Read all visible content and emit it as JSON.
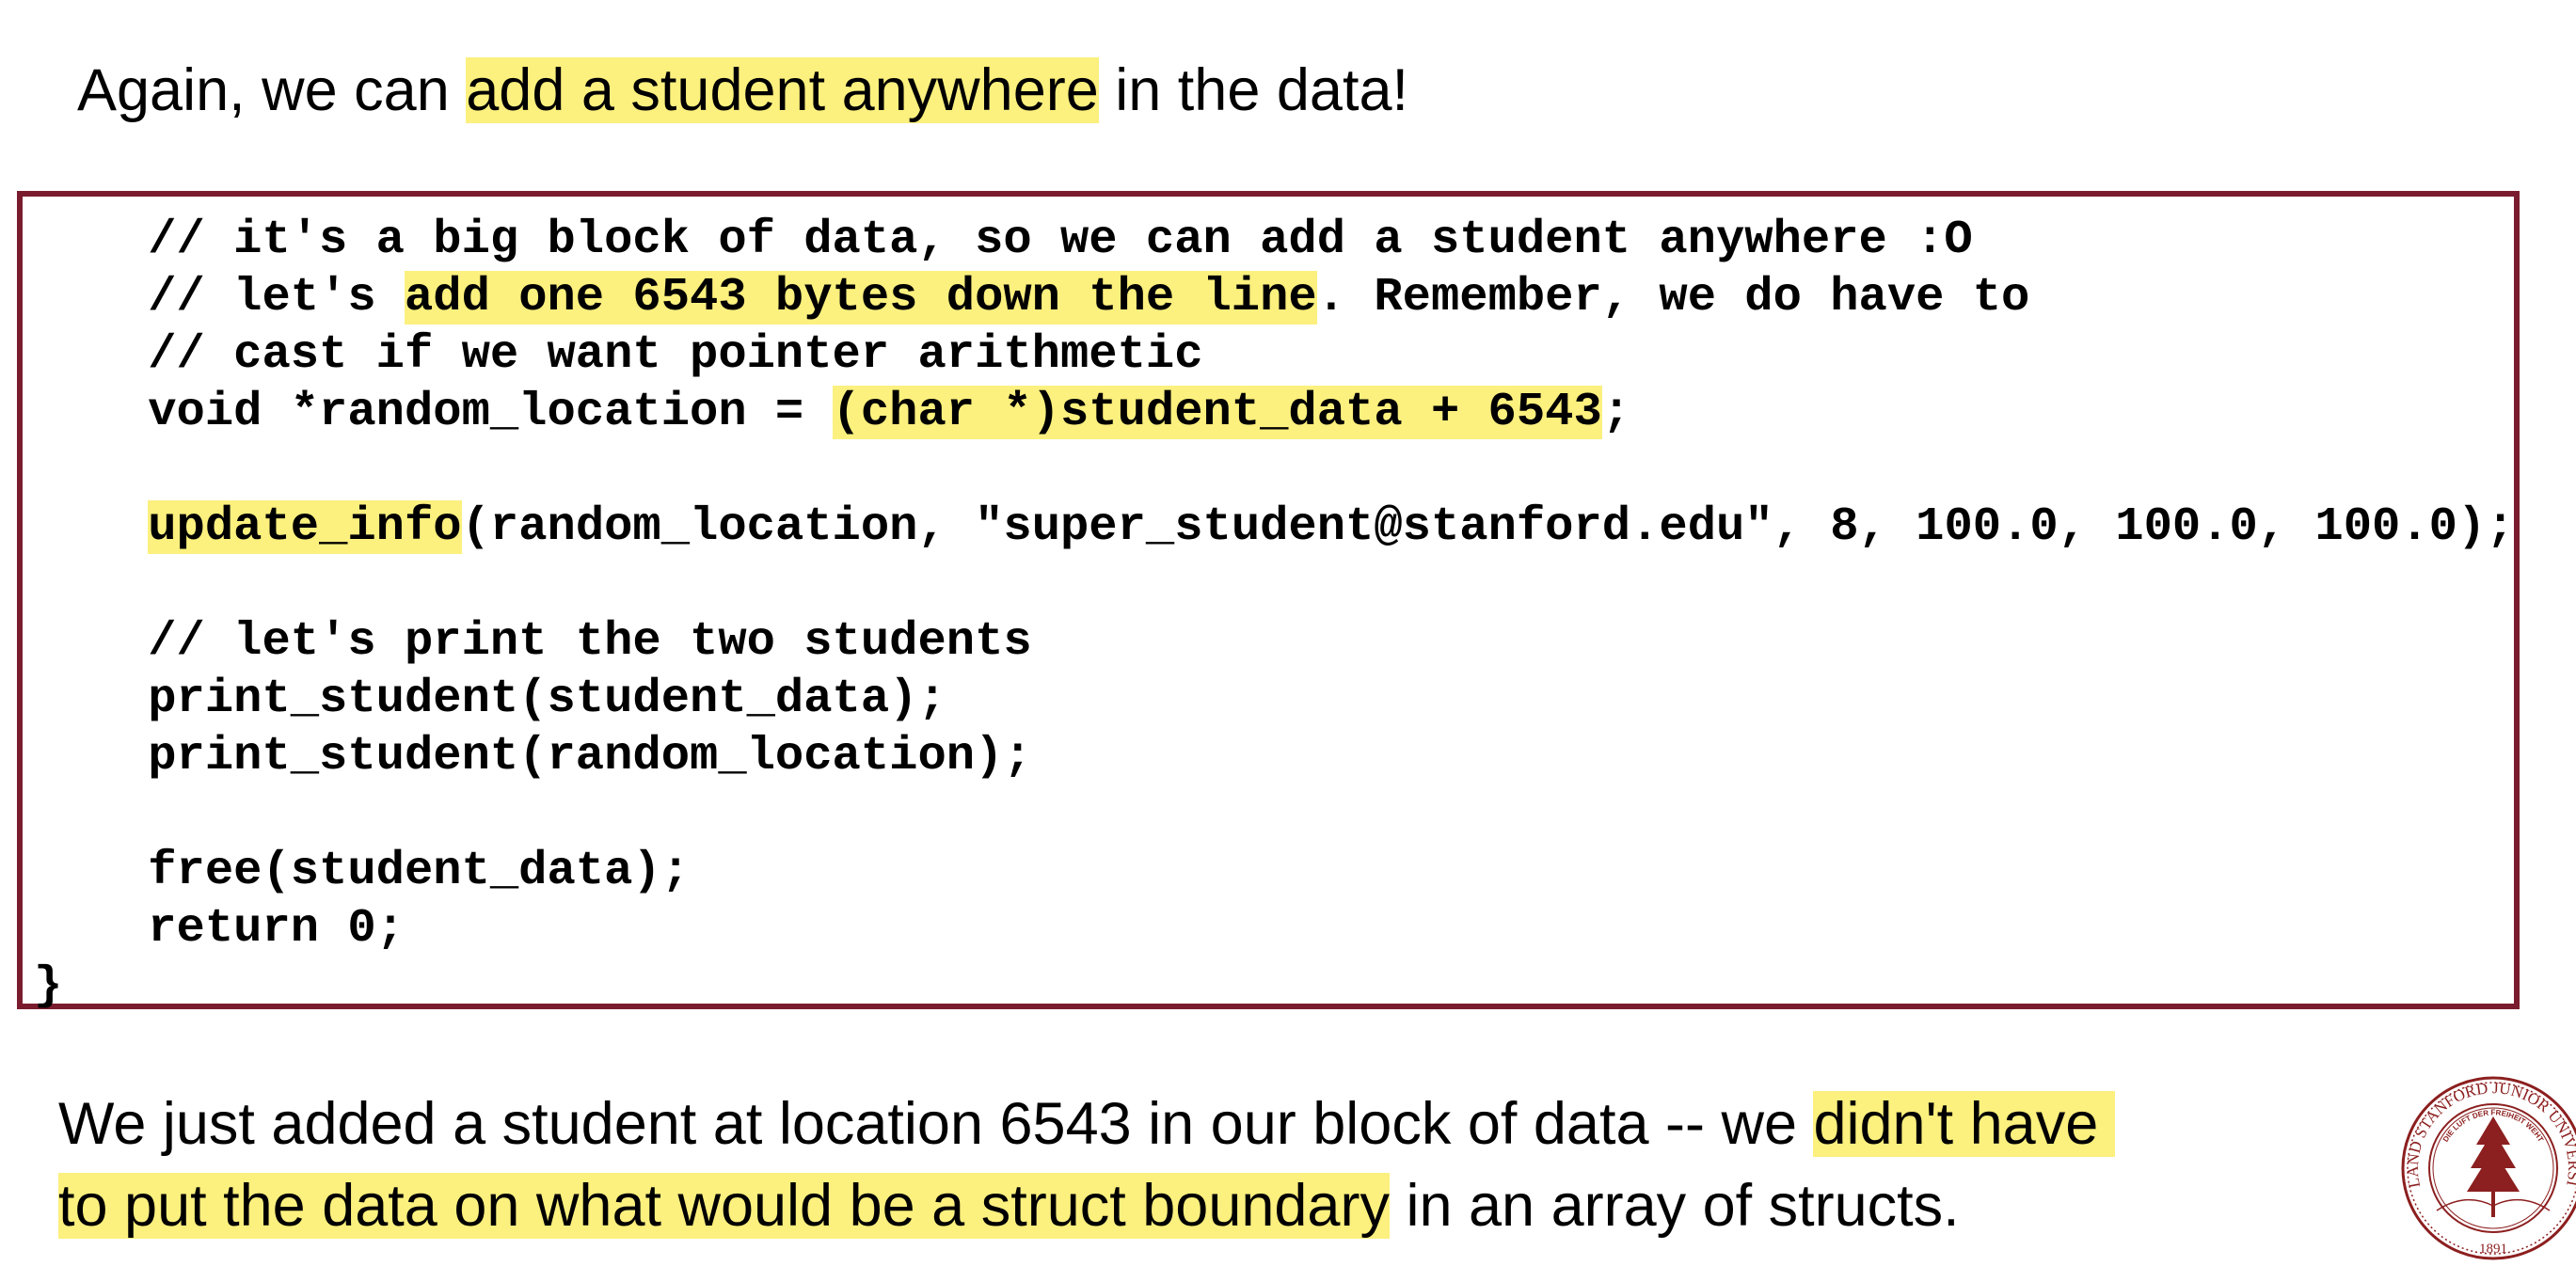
{
  "title": {
    "before": "Again, we can ",
    "highlight": "add a student anywhere",
    "after": " in the data!"
  },
  "code_lines": [
    [
      {
        "t": "    // it's a big block of data, so we can add a student anywhere :O"
      }
    ],
    [
      {
        "t": "    // let's "
      },
      {
        "t": "add one 6543 bytes down the line",
        "hl": true
      },
      {
        "t": ". Remember, we do have to"
      }
    ],
    [
      {
        "t": "    // cast if we want pointer arithmetic"
      }
    ],
    [
      {
        "t": "    void *random_location = "
      },
      {
        "t": "(char *)student_data + 6543",
        "hl": true
      },
      {
        "t": ";"
      }
    ],
    [
      {
        "t": ""
      }
    ],
    [
      {
        "t": "    "
      },
      {
        "t": "update_info",
        "hl": true
      },
      {
        "t": "(random_location, \"super_student@stanford.edu\", 8, 100.0, 100.0, 100.0);"
      }
    ],
    [
      {
        "t": ""
      }
    ],
    [
      {
        "t": "    // let's print the two students"
      }
    ],
    [
      {
        "t": "    print_student(student_data);"
      }
    ],
    [
      {
        "t": "    print_student(random_location);"
      }
    ],
    [
      {
        "t": ""
      }
    ],
    [
      {
        "t": "    free(student_data);"
      }
    ],
    [
      {
        "t": "    return 0;"
      }
    ],
    [
      {
        "t": "}"
      }
    ]
  ],
  "caption": {
    "line1_before": "We just added a student at location 6543 in our block of data -- we ",
    "line1_highlight": "didn't have ",
    "line2_highlight": "to put the data on what would be a struct boundary",
    "line2_after": " in an array of structs."
  },
  "seal": {
    "outer_text": "LELAND STANFORD JUNIOR UNIVERSITY",
    "inner_text": "DIE LUFT DER FREIHEIT WEHT",
    "year": "1891"
  },
  "colors": {
    "highlight": "#fcf07e",
    "border": "#7a1c2e"
  }
}
